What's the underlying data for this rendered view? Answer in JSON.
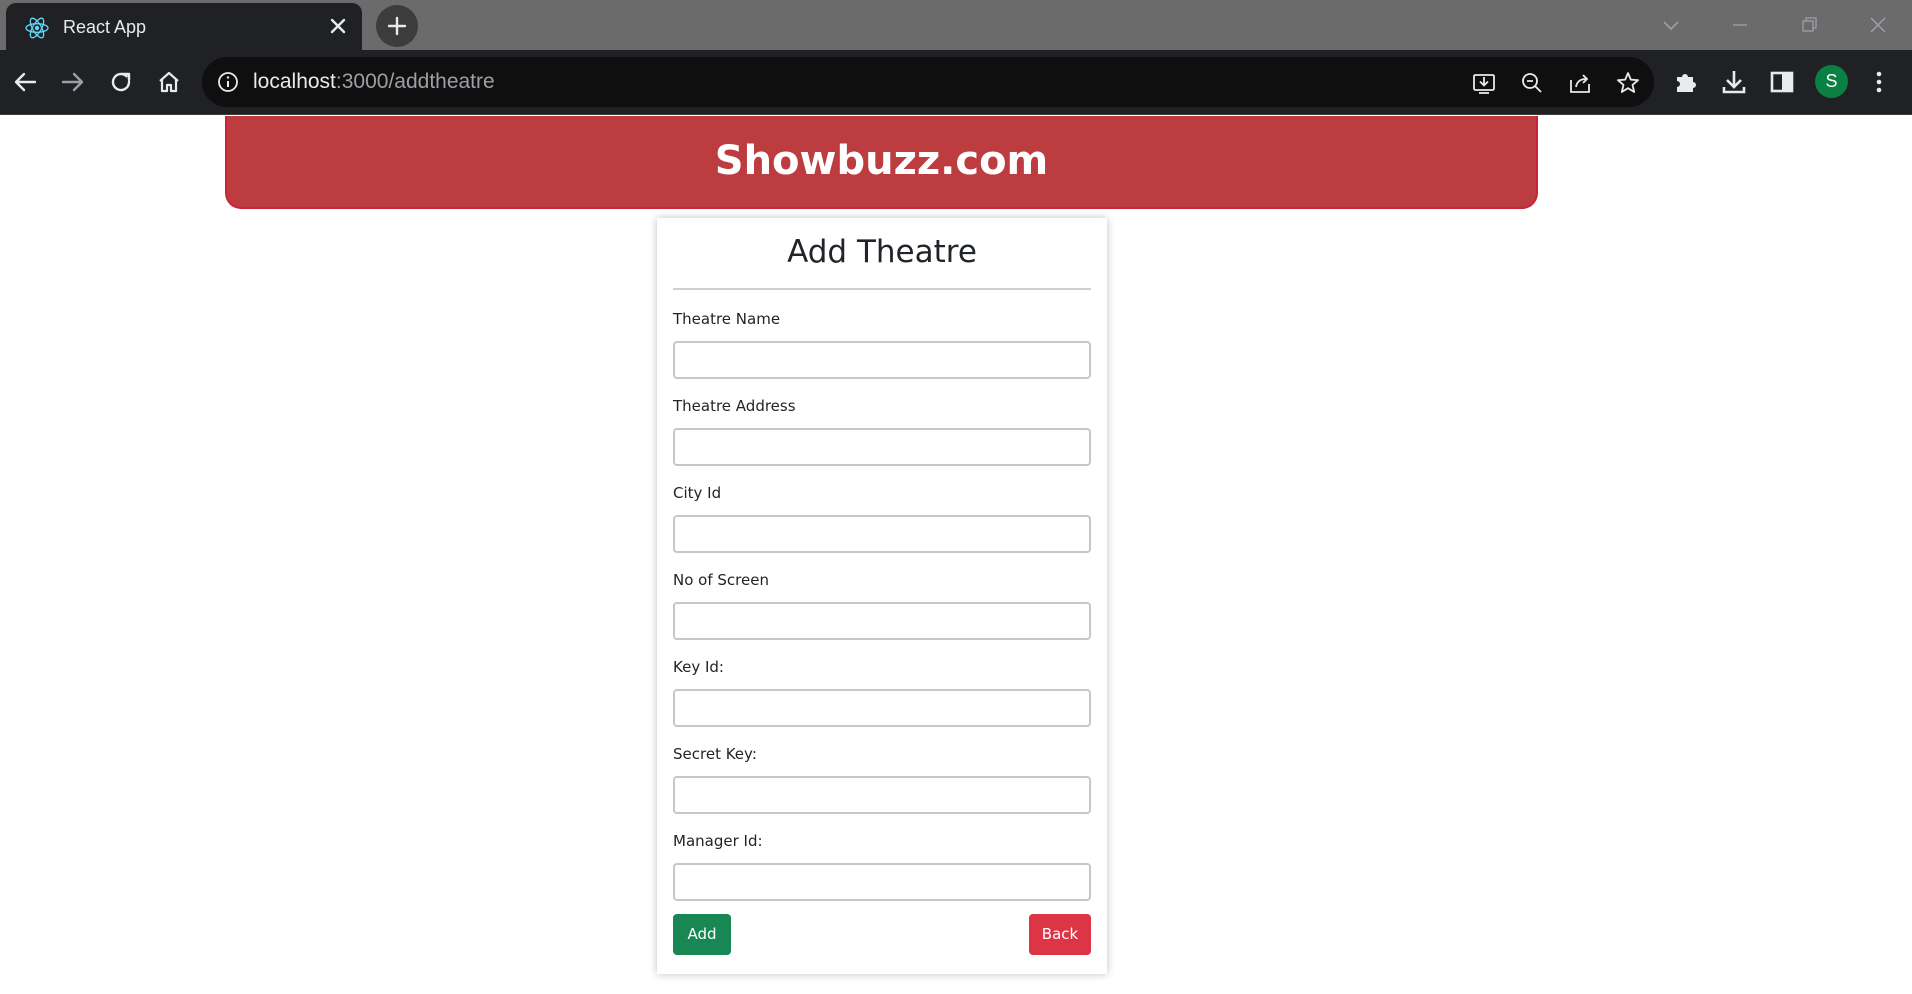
{
  "browser": {
    "tab_title": "React App",
    "url_host": "localhost",
    "url_rest": ":3000/addtheatre",
    "profile_initial": "S",
    "profile_color": "#0b8043"
  },
  "page": {
    "banner_title": "Showbuzz.com",
    "banner_color": "#bd3c3f",
    "form": {
      "title": "Add Theatre",
      "fields": [
        {
          "label": "Theatre Name",
          "value": ""
        },
        {
          "label": "Theatre Address",
          "value": ""
        },
        {
          "label": "City Id",
          "value": ""
        },
        {
          "label": "No of Screen",
          "value": ""
        },
        {
          "label": "Key Id:",
          "value": ""
        },
        {
          "label": "Secret Key:",
          "value": ""
        },
        {
          "label": "Manager Id:",
          "value": ""
        }
      ],
      "add_label": "Add",
      "back_label": "Back",
      "add_color": "#198754",
      "back_color": "#dc3545"
    }
  }
}
